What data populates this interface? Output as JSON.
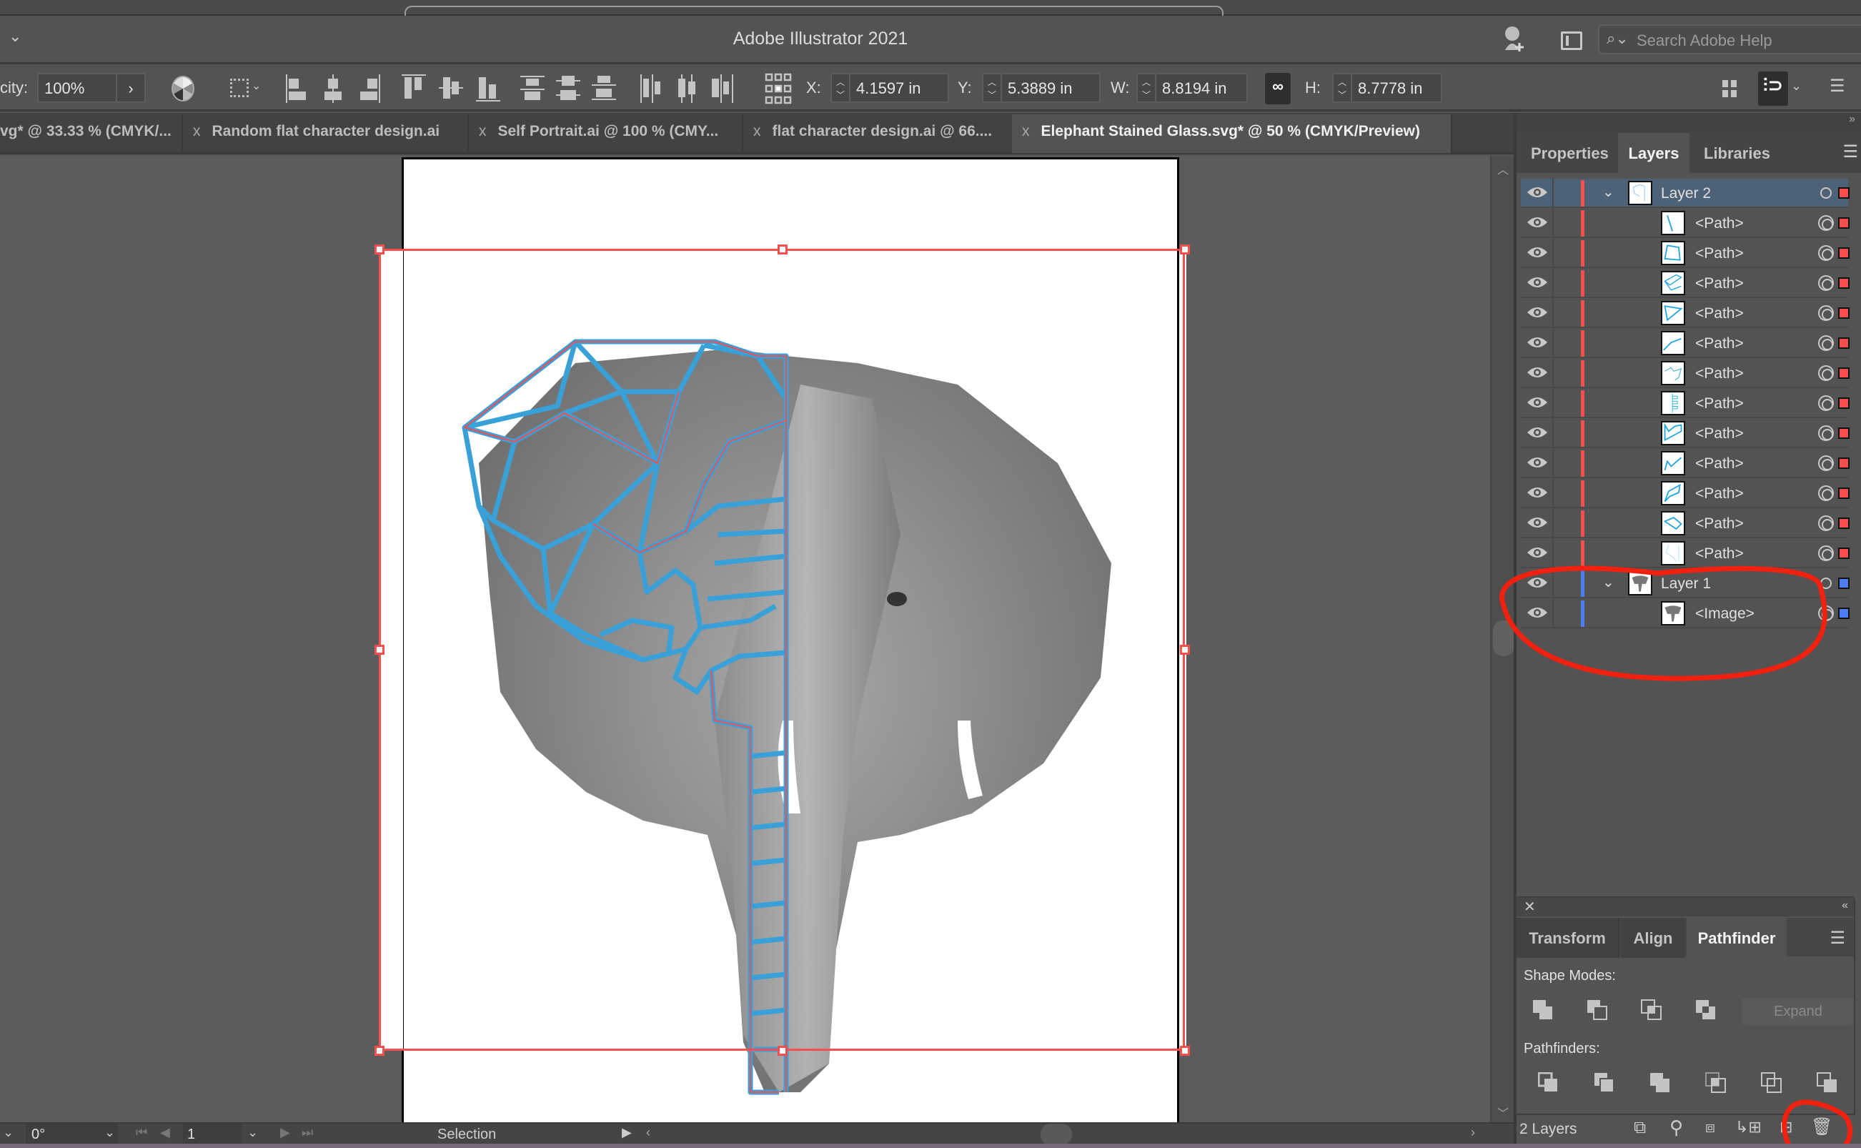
{
  "window": {
    "title": "Adobe Illustrator 2021",
    "search_placeholder": "Search Adobe Help"
  },
  "control_bar": {
    "opacity_label": "city:",
    "opacity_value": "100%",
    "x_label": "X:",
    "x_value": "4.1597 in",
    "y_label": "Y:",
    "y_value": "5.3889 in",
    "w_label": "W:",
    "w_value": "8.8194 in",
    "h_label": "H:",
    "h_value": "8.7778 in",
    "icons": [
      "recolor-artwork-icon",
      "align-to-selection-icon",
      "horizontal-align-left-icon",
      "horizontal-align-center-icon",
      "horizontal-align-right-icon",
      "vertical-align-top-icon",
      "vertical-align-center-icon",
      "vertical-align-bottom-icon",
      "vertical-distribute-top-icon",
      "vertical-distribute-center-icon",
      "vertical-distribute-bottom-icon",
      "horizontal-distribute-left-icon",
      "horizontal-distribute-center-icon",
      "horizontal-distribute-right-icon",
      "reference-point-icon",
      "constrain-proportions-icon",
      "grid-icon",
      "snap-icon",
      "panel-menu-icon"
    ]
  },
  "doc_tabs": [
    {
      "label": "vg* @ 33.33 % (CMYK/...",
      "active": false
    },
    {
      "label": "Random flat character design.ai",
      "active": false
    },
    {
      "label": "Self Portrait.ai @ 100 % (CMY...",
      "active": false
    },
    {
      "label": "flat character design.ai @ 66....",
      "active": false
    },
    {
      "label": "Elephant Stained Glass.svg* @ 50 % (CMYK/Preview)",
      "active": true
    }
  ],
  "tab_close_glyph": "x",
  "panel_top": {
    "tabs": [
      "Properties",
      "Layers",
      "Libraries"
    ],
    "active_tab": "Layers"
  },
  "layers": [
    {
      "name": "Layer 2",
      "type": "layer",
      "expanded": true,
      "color": "#f74e4e",
      "selected": true
    },
    {
      "name": "<Path>",
      "type": "path",
      "color": "#f74e4e"
    },
    {
      "name": "<Path>",
      "type": "path",
      "color": "#f74e4e"
    },
    {
      "name": "<Path>",
      "type": "path",
      "color": "#f74e4e"
    },
    {
      "name": "<Path>",
      "type": "path",
      "color": "#f74e4e"
    },
    {
      "name": "<Path>",
      "type": "path",
      "color": "#f74e4e"
    },
    {
      "name": "<Path>",
      "type": "path",
      "color": "#f74e4e"
    },
    {
      "name": "<Path>",
      "type": "path",
      "color": "#f74e4e"
    },
    {
      "name": "<Path>",
      "type": "path",
      "color": "#f74e4e"
    },
    {
      "name": "<Path>",
      "type": "path",
      "color": "#f74e4e"
    },
    {
      "name": "<Path>",
      "type": "path",
      "color": "#f74e4e"
    },
    {
      "name": "<Path>",
      "type": "path",
      "color": "#f74e4e"
    },
    {
      "name": "<Path>",
      "type": "path",
      "color": "#f74e4e"
    },
    {
      "name": "Layer 1",
      "type": "layer",
      "expanded": true,
      "color": "#4c7ef5"
    },
    {
      "name": "<Image>",
      "type": "image",
      "color": "#4c7ef5"
    }
  ],
  "panel_bottom": {
    "tabs": [
      "Transform",
      "Align",
      "Pathfinder"
    ],
    "active_tab": "Pathfinder",
    "shape_modes_label": "Shape Modes:",
    "pathfinders_label": "Pathfinders:",
    "expand_label": "Expand",
    "shape_mode_icons": [
      "unite-icon",
      "minus-front-icon",
      "intersect-icon",
      "exclude-icon"
    ],
    "pathfinder_icons": [
      "divide-icon",
      "trim-icon",
      "merge-icon",
      "crop-icon",
      "outline-icon",
      "minus-back-icon"
    ]
  },
  "layers_footer": {
    "count_label": "2 Layers",
    "icons": [
      "export-icon",
      "locate-object-icon",
      "make-clipping-mask-icon",
      "new-sublayer-icon",
      "new-layer-icon",
      "delete-icon"
    ]
  },
  "status_bar": {
    "rotation": "0°",
    "artboard_number": "1",
    "tool": "Selection"
  },
  "colors": {
    "selection_red": "#f74e4e",
    "layer1_blue": "#4c7ef5",
    "path_blue": "#3aa0d8",
    "annotation_red": "#f2200f"
  }
}
